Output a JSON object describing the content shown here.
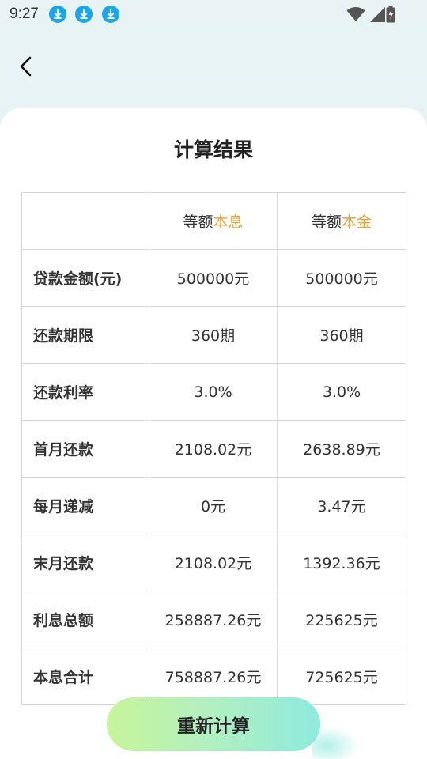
{
  "status_bar": {
    "time": "9:27",
    "download_icons": [
      "download-icon",
      "download-icon",
      "download-icon"
    ],
    "right_icons": [
      "wifi-icon",
      "signal-icon",
      "battery-charging-icon"
    ]
  },
  "nav": {
    "back_icon": "chevron-left-icon"
  },
  "page": {
    "title": "计算结果"
  },
  "table": {
    "header": {
      "col1_prefix": "等额",
      "col1_highlight": "本息",
      "col2_prefix": "等额",
      "col2_highlight": "本金"
    },
    "rows": [
      {
        "label": "贷款金额(元)",
        "v1": "500000元",
        "v2": "500000元"
      },
      {
        "label": "还款期限",
        "v1": "360期",
        "v2": "360期"
      },
      {
        "label": "还款利率",
        "v1": "3.0%",
        "v2": "3.0%"
      },
      {
        "label": "首月还款",
        "v1": "2108.02元",
        "v2": "2638.89元"
      },
      {
        "label": "每月递减",
        "v1": "0元",
        "v2": "3.47元"
      },
      {
        "label": "末月还款",
        "v1": "2108.02元",
        "v2": "1392.36元"
      },
      {
        "label": "利息总额",
        "v1": "258887.26元",
        "v2": "225625元"
      },
      {
        "label": "本息合计",
        "v1": "758887.26元",
        "v2": "725625元"
      }
    ]
  },
  "actions": {
    "recalculate_label": "重新计算"
  },
  "colors": {
    "highlight": "#e8a23a",
    "download_badge": "#1aa6e8",
    "button_gradient_start": "#c7f59a",
    "button_gradient_end": "#8feade"
  }
}
